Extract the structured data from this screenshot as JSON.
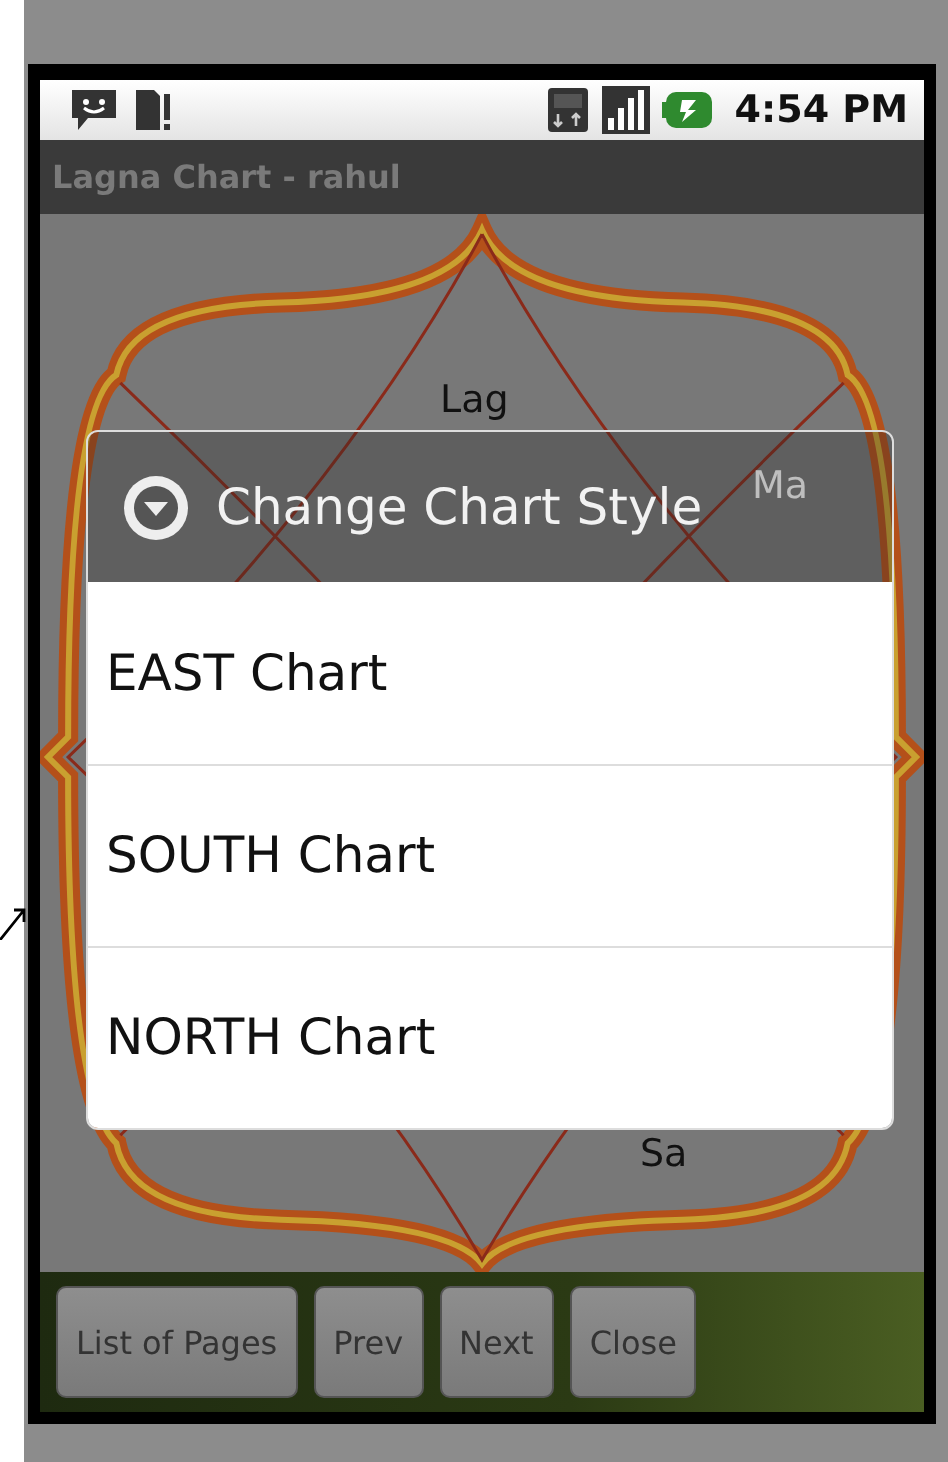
{
  "status_bar": {
    "time": "4:54 PM"
  },
  "title": "Lagna Chart - rahul",
  "chart": {
    "labels": [
      {
        "text": "Lag"
      },
      {
        "text": "Ma"
      },
      {
        "text": "Sa"
      }
    ]
  },
  "dialog": {
    "title": "Change Chart Style",
    "options": [
      {
        "label": "EAST Chart"
      },
      {
        "label": "SOUTH Chart"
      },
      {
        "label": "NORTH Chart"
      }
    ]
  },
  "buttons": [
    "List of Pages",
    "Prev",
    "Next",
    "Close"
  ]
}
